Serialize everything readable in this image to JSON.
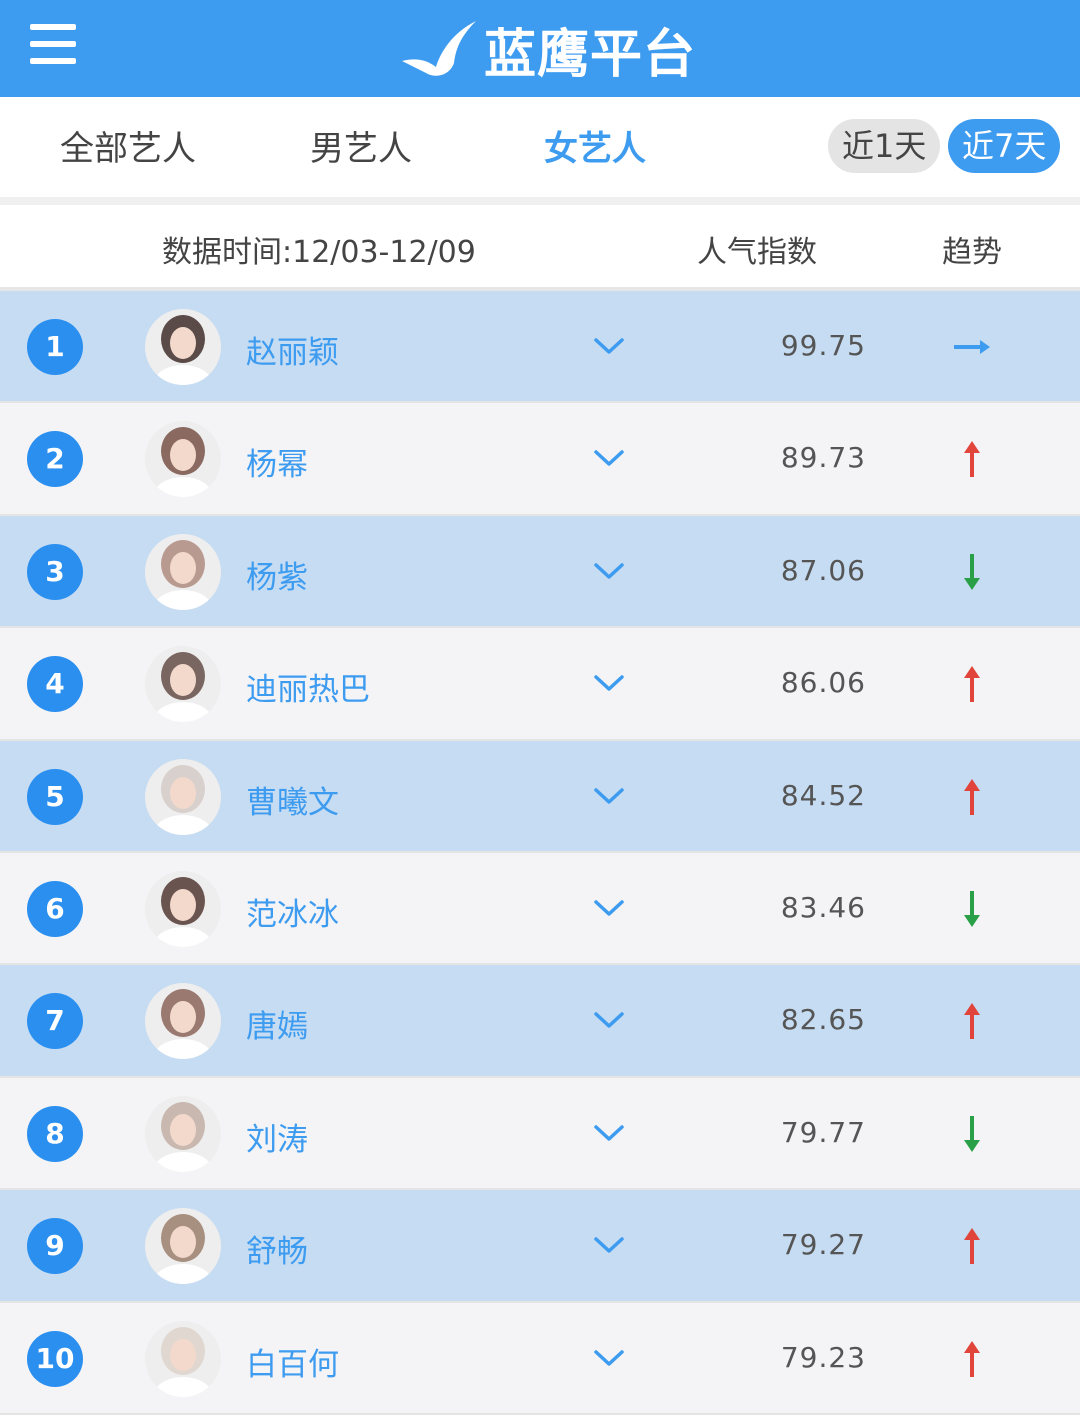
{
  "header": {
    "brand": "蓝鹰平台"
  },
  "tabs": [
    {
      "label": "全部艺人",
      "active": false
    },
    {
      "label": "男艺人",
      "active": false
    },
    {
      "label": "女艺人",
      "active": true
    }
  ],
  "range": {
    "day1": "近1天",
    "day7": "近7天",
    "selected": "近7天"
  },
  "columns": {
    "time": "数据时间:12/03-12/09",
    "score": "人气指数",
    "trend": "趋势"
  },
  "colors": {
    "brand": "#3d9bf0",
    "rowHighlight": "#c6dcf2",
    "up": "#e0443a",
    "down": "#29a047",
    "flat": "#3d9bf0"
  },
  "rows": [
    {
      "rank": "1",
      "name": "赵丽颖",
      "score": "99.75",
      "trend": "flat"
    },
    {
      "rank": "2",
      "name": "杨幂",
      "score": "89.73",
      "trend": "up"
    },
    {
      "rank": "3",
      "name": "杨紫",
      "score": "87.06",
      "trend": "down"
    },
    {
      "rank": "4",
      "name": "迪丽热巴",
      "score": "86.06",
      "trend": "up"
    },
    {
      "rank": "5",
      "name": "曹曦文",
      "score": "84.52",
      "trend": "up"
    },
    {
      "rank": "6",
      "name": "范冰冰",
      "score": "83.46",
      "trend": "down"
    },
    {
      "rank": "7",
      "name": "唐嫣",
      "score": "82.65",
      "trend": "up"
    },
    {
      "rank": "8",
      "name": "刘涛",
      "score": "79.77",
      "trend": "down"
    },
    {
      "rank": "9",
      "name": "舒畅",
      "score": "79.27",
      "trend": "up"
    },
    {
      "rank": "10",
      "name": "白百何",
      "score": "79.23",
      "trend": "up"
    }
  ]
}
